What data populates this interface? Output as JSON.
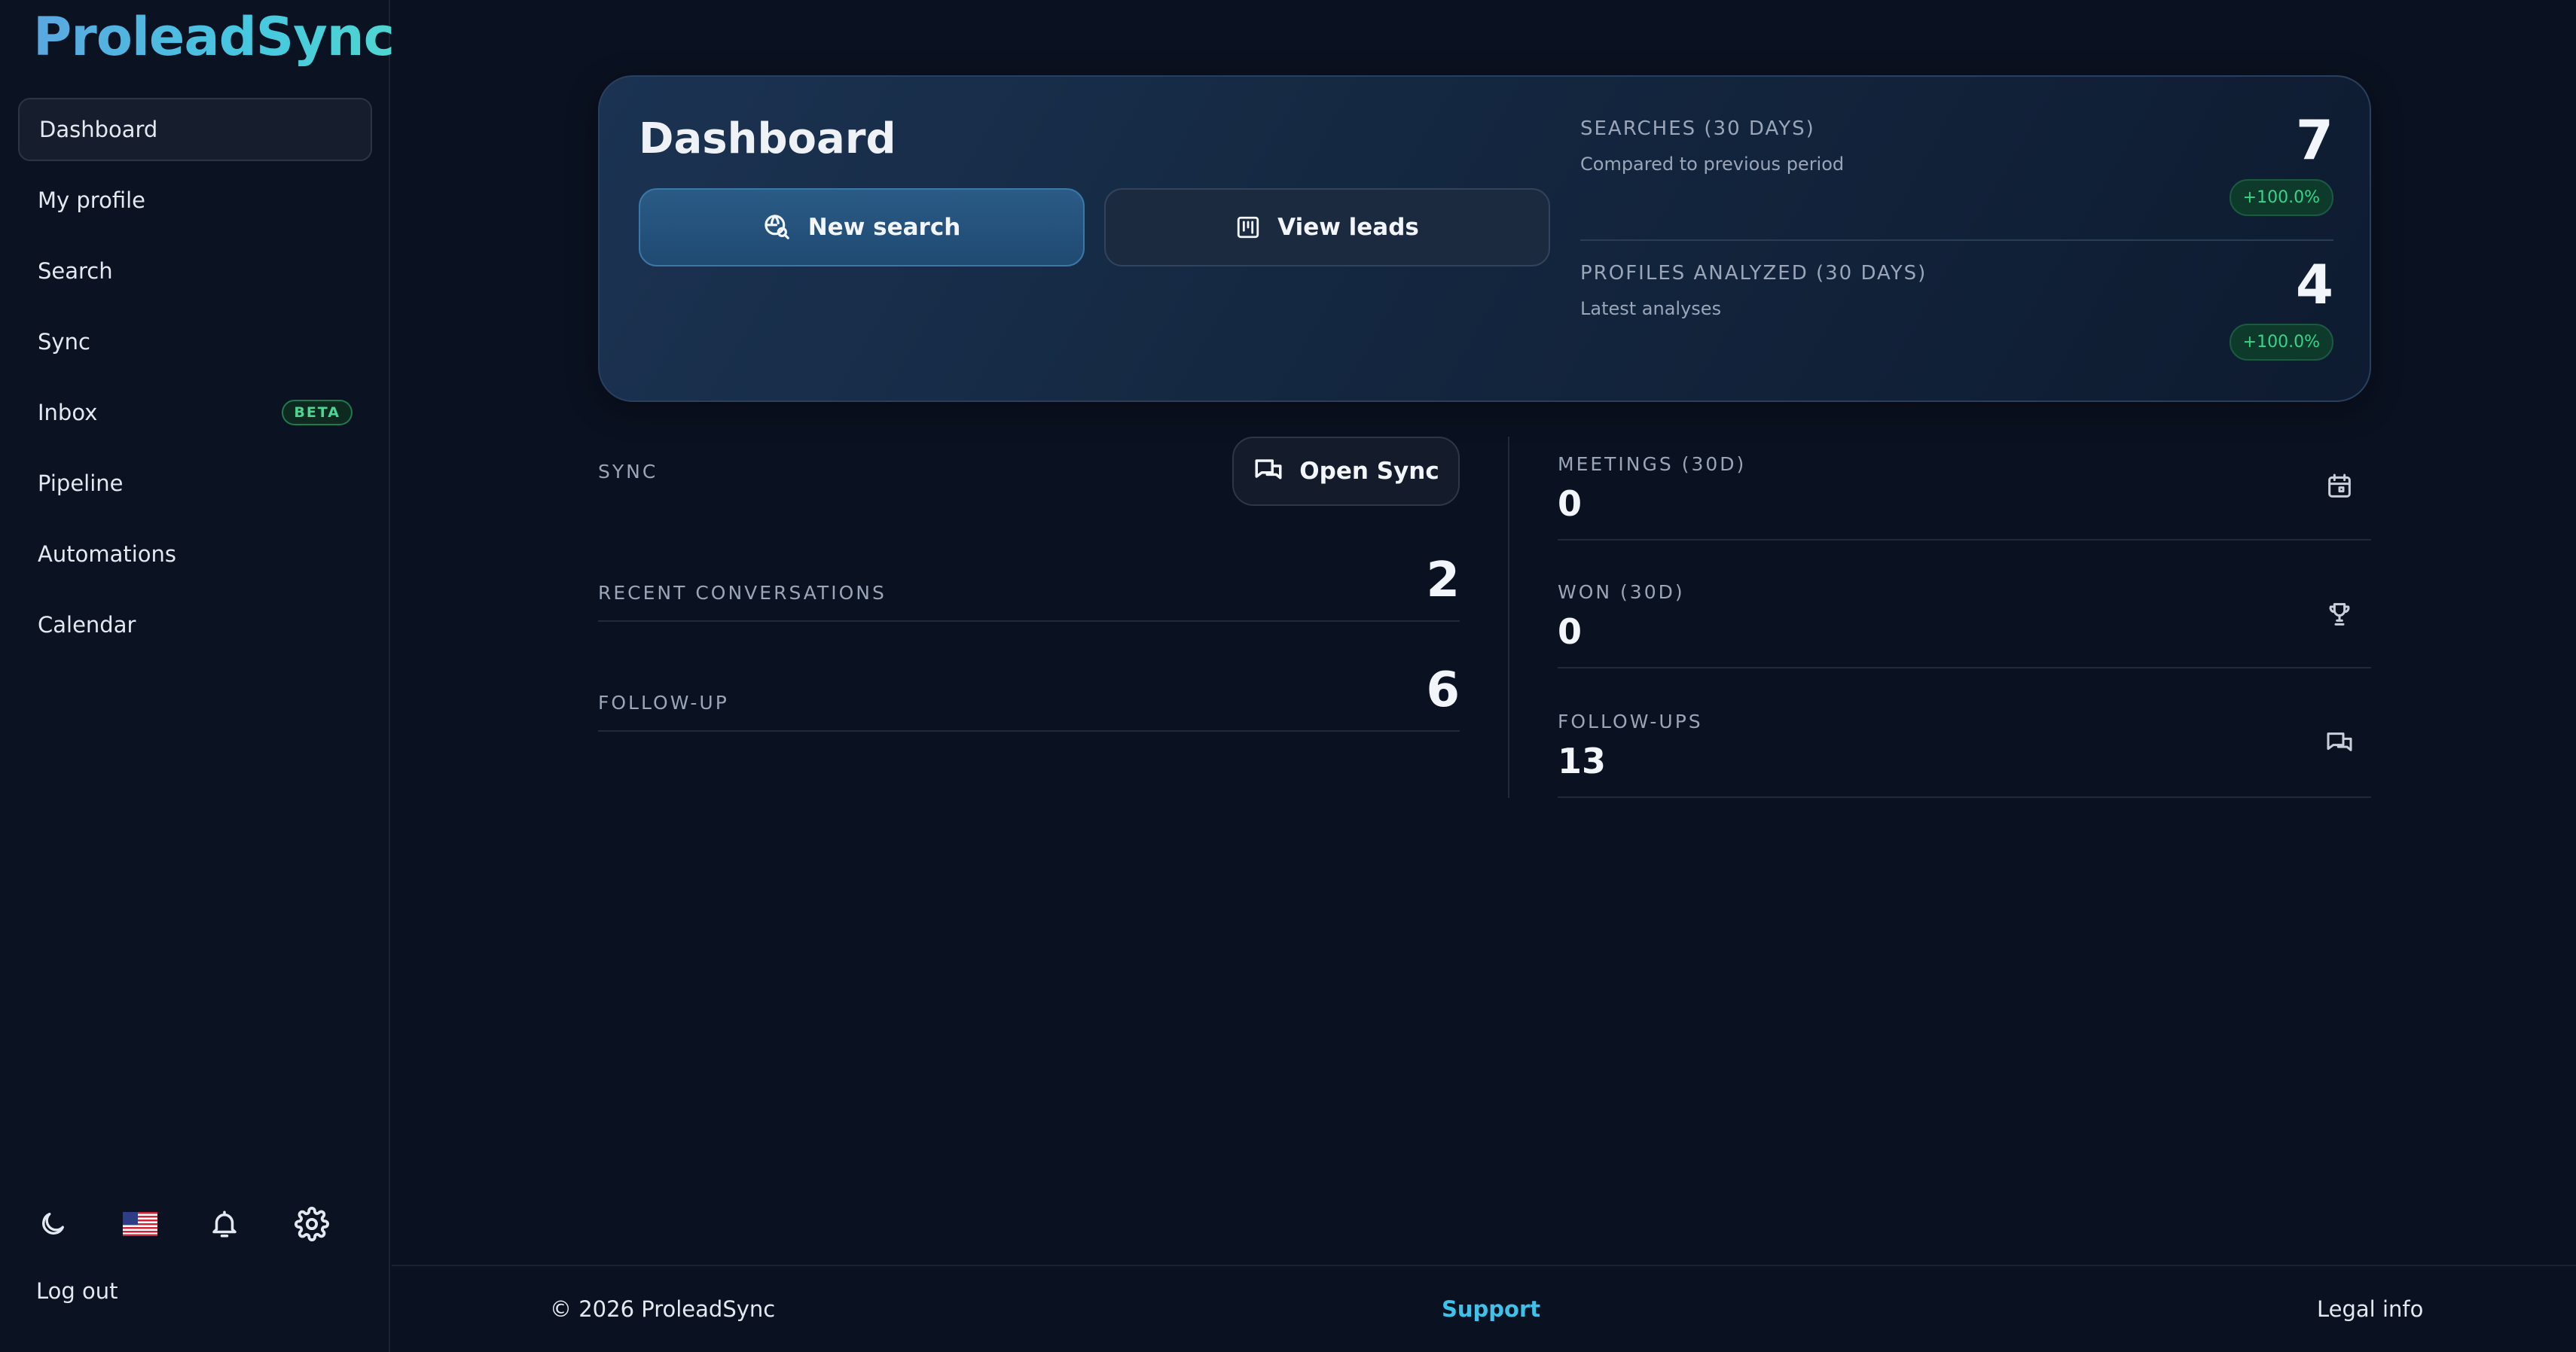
{
  "app": {
    "name": "ProleadSync"
  },
  "sidebar": {
    "items": [
      {
        "label": "Dashboard",
        "active": true
      },
      {
        "label": "My profile"
      },
      {
        "label": "Search"
      },
      {
        "label": "Sync"
      },
      {
        "label": "Inbox",
        "badge": "BETA"
      },
      {
        "label": "Pipeline"
      },
      {
        "label": "Automations"
      },
      {
        "label": "Calendar"
      }
    ],
    "tools": [
      "moon-icon",
      "us-flag-icon",
      "bell-icon",
      "gear-icon"
    ],
    "logout": "Log out"
  },
  "hero": {
    "title": "Dashboard",
    "buttons": {
      "new_search": "New search",
      "view_leads": "View leads"
    },
    "stats": [
      {
        "label": "SEARCHES (30 DAYS)",
        "sub": "Compared to previous period",
        "value": "7",
        "change": "+100.0%"
      },
      {
        "label": "PROFILES ANALYZED (30 DAYS)",
        "sub": "Latest analyses",
        "value": "4",
        "change": "+100.0%"
      }
    ]
  },
  "sync": {
    "label": "SYNC",
    "open_button": "Open Sync",
    "metrics": [
      {
        "label": "RECENT CONVERSATIONS",
        "value": "2"
      },
      {
        "label": "FOLLOW-UP",
        "value": "6"
      }
    ]
  },
  "kpis": [
    {
      "label": "MEETINGS (30D)",
      "value": "0",
      "icon": "calendar-icon"
    },
    {
      "label": "WON (30D)",
      "value": "0",
      "icon": "trophy-icon"
    },
    {
      "label": "FOLLOW-UPS",
      "value": "13",
      "icon": "chat-icon"
    }
  ],
  "footer": {
    "copyright": "© 2026 ProleadSync",
    "support": "Support",
    "legal": "Legal info"
  },
  "colors": {
    "background": "#0a1120",
    "accent": "#3fc1ea",
    "positive": "#37d48a",
    "beta_badge": "#4ad693"
  }
}
